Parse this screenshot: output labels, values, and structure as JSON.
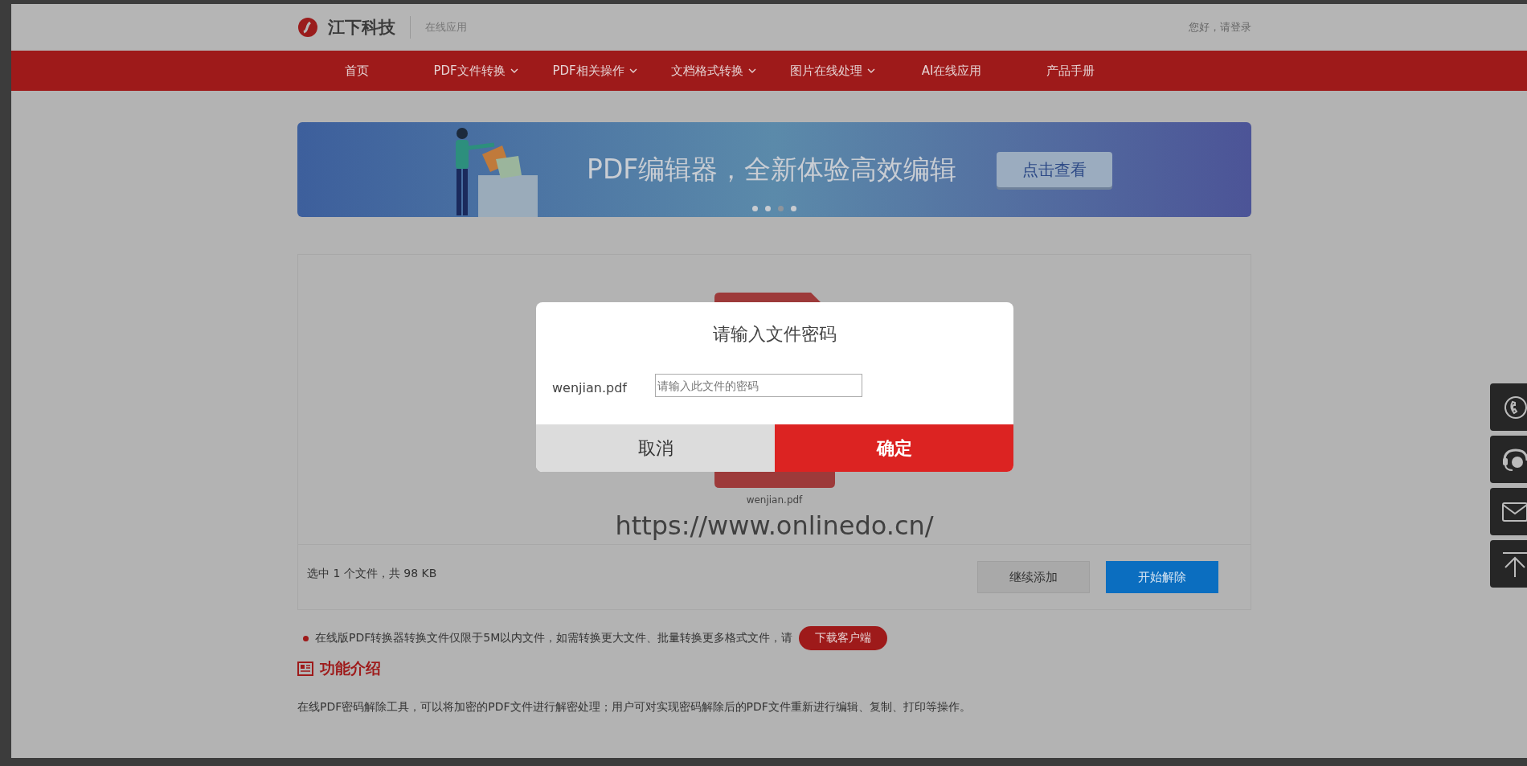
{
  "header": {
    "logo_text": "江下科技",
    "subtitle": "在线应用",
    "login_text": "您好，请登录"
  },
  "nav": [
    {
      "label": "首页",
      "has_dropdown": false
    },
    {
      "label": "PDF文件转换",
      "has_dropdown": true
    },
    {
      "label": "PDF相关操作",
      "has_dropdown": true
    },
    {
      "label": "文档格式转换",
      "has_dropdown": true
    },
    {
      "label": "图片在线处理",
      "has_dropdown": true
    },
    {
      "label": "AI在线应用",
      "has_dropdown": false
    },
    {
      "label": "产品手册",
      "has_dropdown": false
    }
  ],
  "banner": {
    "headline": "PDF编辑器，全新体验高效编辑",
    "button": "点击查看",
    "dots": [
      {
        "selected": false
      },
      {
        "selected": false
      },
      {
        "selected": true
      },
      {
        "selected": false
      }
    ]
  },
  "upload": {
    "file_name": "wenjian.pdf",
    "url_text": "https://www.onlinedo.cn/",
    "summary": "选中 1 个文件，共 98 KB",
    "add_button": "继续添加",
    "start_button": "开始解除"
  },
  "notice": {
    "text": "在线版PDF转换器转换文件仅限于5M以内文件，如需转换更大文件、批量转换更多格式文件，请",
    "button": "下载客户端"
  },
  "section": {
    "title": "功能介绍",
    "description": "在线PDF密码解除工具，可以将加密的PDF文件进行解密处理；用户可对实现密码解除后的PDF文件重新进行编辑、复制、打印等操作。"
  },
  "dialog": {
    "title": "请输入文件密码",
    "file_label": "wenjian.pdf",
    "placeholder": "请输入此文件的密码",
    "cancel": "取消",
    "confirm": "确定"
  }
}
